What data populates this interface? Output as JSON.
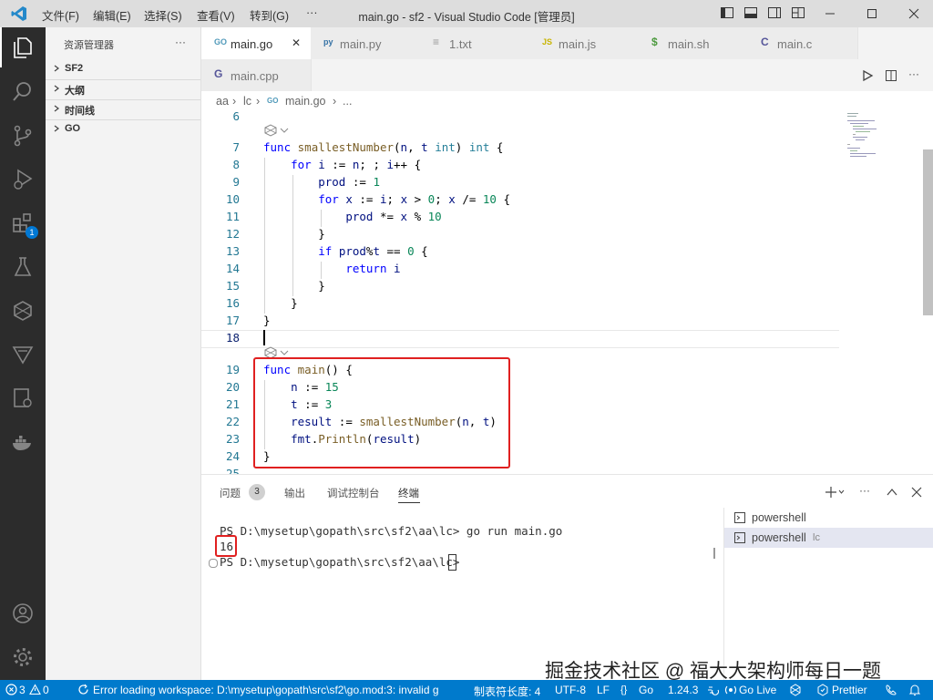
{
  "titlebar": {
    "menus": [
      "文件(F)",
      "编辑(E)",
      "选择(S)",
      "查看(V)",
      "转到(G)",
      "···"
    ],
    "title": "main.go - sf2 - Visual Studio Code [管理员]"
  },
  "activitybar": {
    "extensions_badge": "1"
  },
  "sidebar": {
    "header": "资源管理器",
    "more": "···",
    "sections": [
      "SF2",
      "大纲",
      "时间线",
      "GO"
    ]
  },
  "tabs": {
    "items": [
      {
        "label": "main.go",
        "icon": "GO",
        "icon_color": "#519aba",
        "active": true,
        "close": "✕"
      },
      {
        "label": "main.py",
        "icon": "py",
        "icon_color": "#3572a5"
      },
      {
        "label": "1.txt",
        "icon": "≡",
        "icon_color": "#999999"
      },
      {
        "label": "main.js",
        "icon": "JS",
        "icon_color": "#c8b400"
      },
      {
        "label": "main.sh",
        "icon": "$",
        "icon_color": "#4d9a3f"
      },
      {
        "label": "main.c",
        "icon": "C",
        "icon_color": "#555599"
      },
      {
        "label": "main.cpp",
        "icon": "G",
        "icon_color": "#555599"
      }
    ]
  },
  "breadcrumb": {
    "parts": [
      "aa",
      "lc",
      "main.go",
      "..."
    ]
  },
  "editor": {
    "lines": [
      "6",
      "7",
      "8",
      "9",
      "10",
      "11",
      "12",
      "13",
      "14",
      "15",
      "16",
      "17",
      "18",
      "19",
      "20",
      "21",
      "22",
      "23",
      "24",
      "25"
    ],
    "current_line": "18"
  },
  "panel": {
    "tabs": [
      "问题",
      "输出",
      "调试控制台",
      "终端"
    ],
    "problems_count": "3",
    "active_tab": "终端",
    "terminal_lines": [
      "PS D:\\mysetup\\gopath\\src\\sf2\\aa\\lc> go run main.go",
      "16",
      "PS D:\\mysetup\\gopath\\src\\sf2\\aa\\lc> "
    ],
    "terminal_list": [
      "powershell",
      "powershell"
    ],
    "terminal_list_suffix": "lc"
  },
  "statusbar": {
    "errors": "3",
    "warnings": "0",
    "message": "Error loading workspace: D:\\mysetup\\gopath\\src\\sf2\\go.mod:3: invalid g",
    "tab_size": "制表符长度: 4",
    "encoding": "UTF-8",
    "eol": "LF",
    "language": "Go",
    "go_version": "1.24.3",
    "go_live": "Go Live",
    "prettier": "Prettier"
  },
  "watermark": "掘金技术社区 @ 福大大架构师每日一题",
  "colors": {
    "accent": "#007acc",
    "activity_bar": "#2c2c2c",
    "highlight": "#e02020"
  }
}
